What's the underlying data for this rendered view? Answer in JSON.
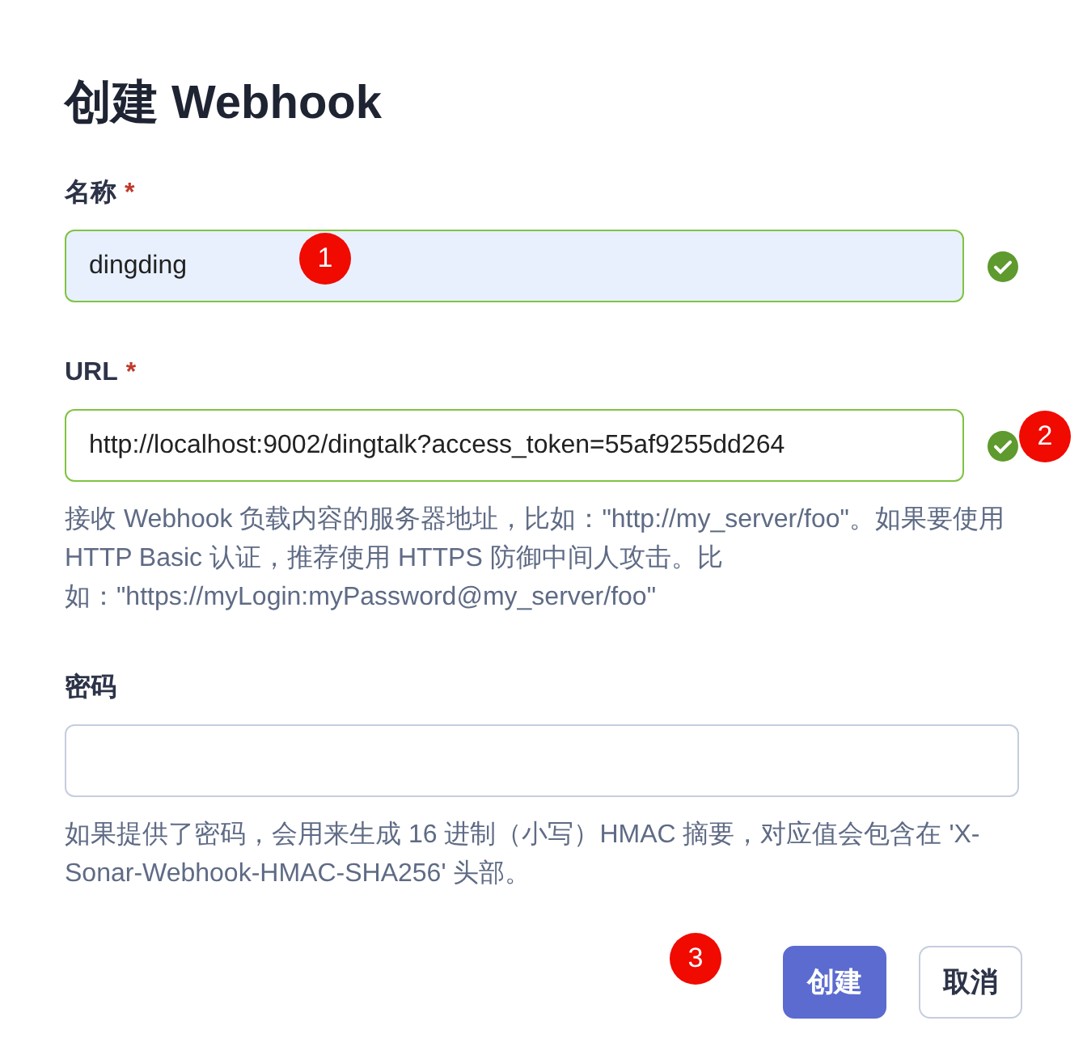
{
  "title": "创建 Webhook",
  "fields": [
    {
      "label": "名称",
      "required_mark": "*",
      "value": "dingding",
      "valid": true
    },
    {
      "label": "URL",
      "required_mark": "*",
      "value": "http://localhost:9002/dingtalk?access_token=55af9255dd264",
      "valid": true,
      "help": "接收 Webhook 负载内容的服务器地址，比如：\"http://my_server/foo\"。如果要使用 HTTP Basic 认证，推荐使用 HTTPS 防御中间人攻击。比如：\"https://myLogin:myPassword@my_server/foo\""
    },
    {
      "label": "密码",
      "valid": false,
      "help": "如果提供了密码，会用来生成 16 进制（小写）HMAC 摘要，对应值会包含在 'X-Sonar-Webhook-HMAC-SHA256' 头部。"
    }
  ],
  "buttons": [
    {
      "label": "创建",
      "kind": "primary"
    },
    {
      "label": "取消",
      "kind": "secondary"
    }
  ],
  "annotations": [
    {
      "label": "1"
    },
    {
      "label": "2"
    },
    {
      "label": "3"
    }
  ]
}
